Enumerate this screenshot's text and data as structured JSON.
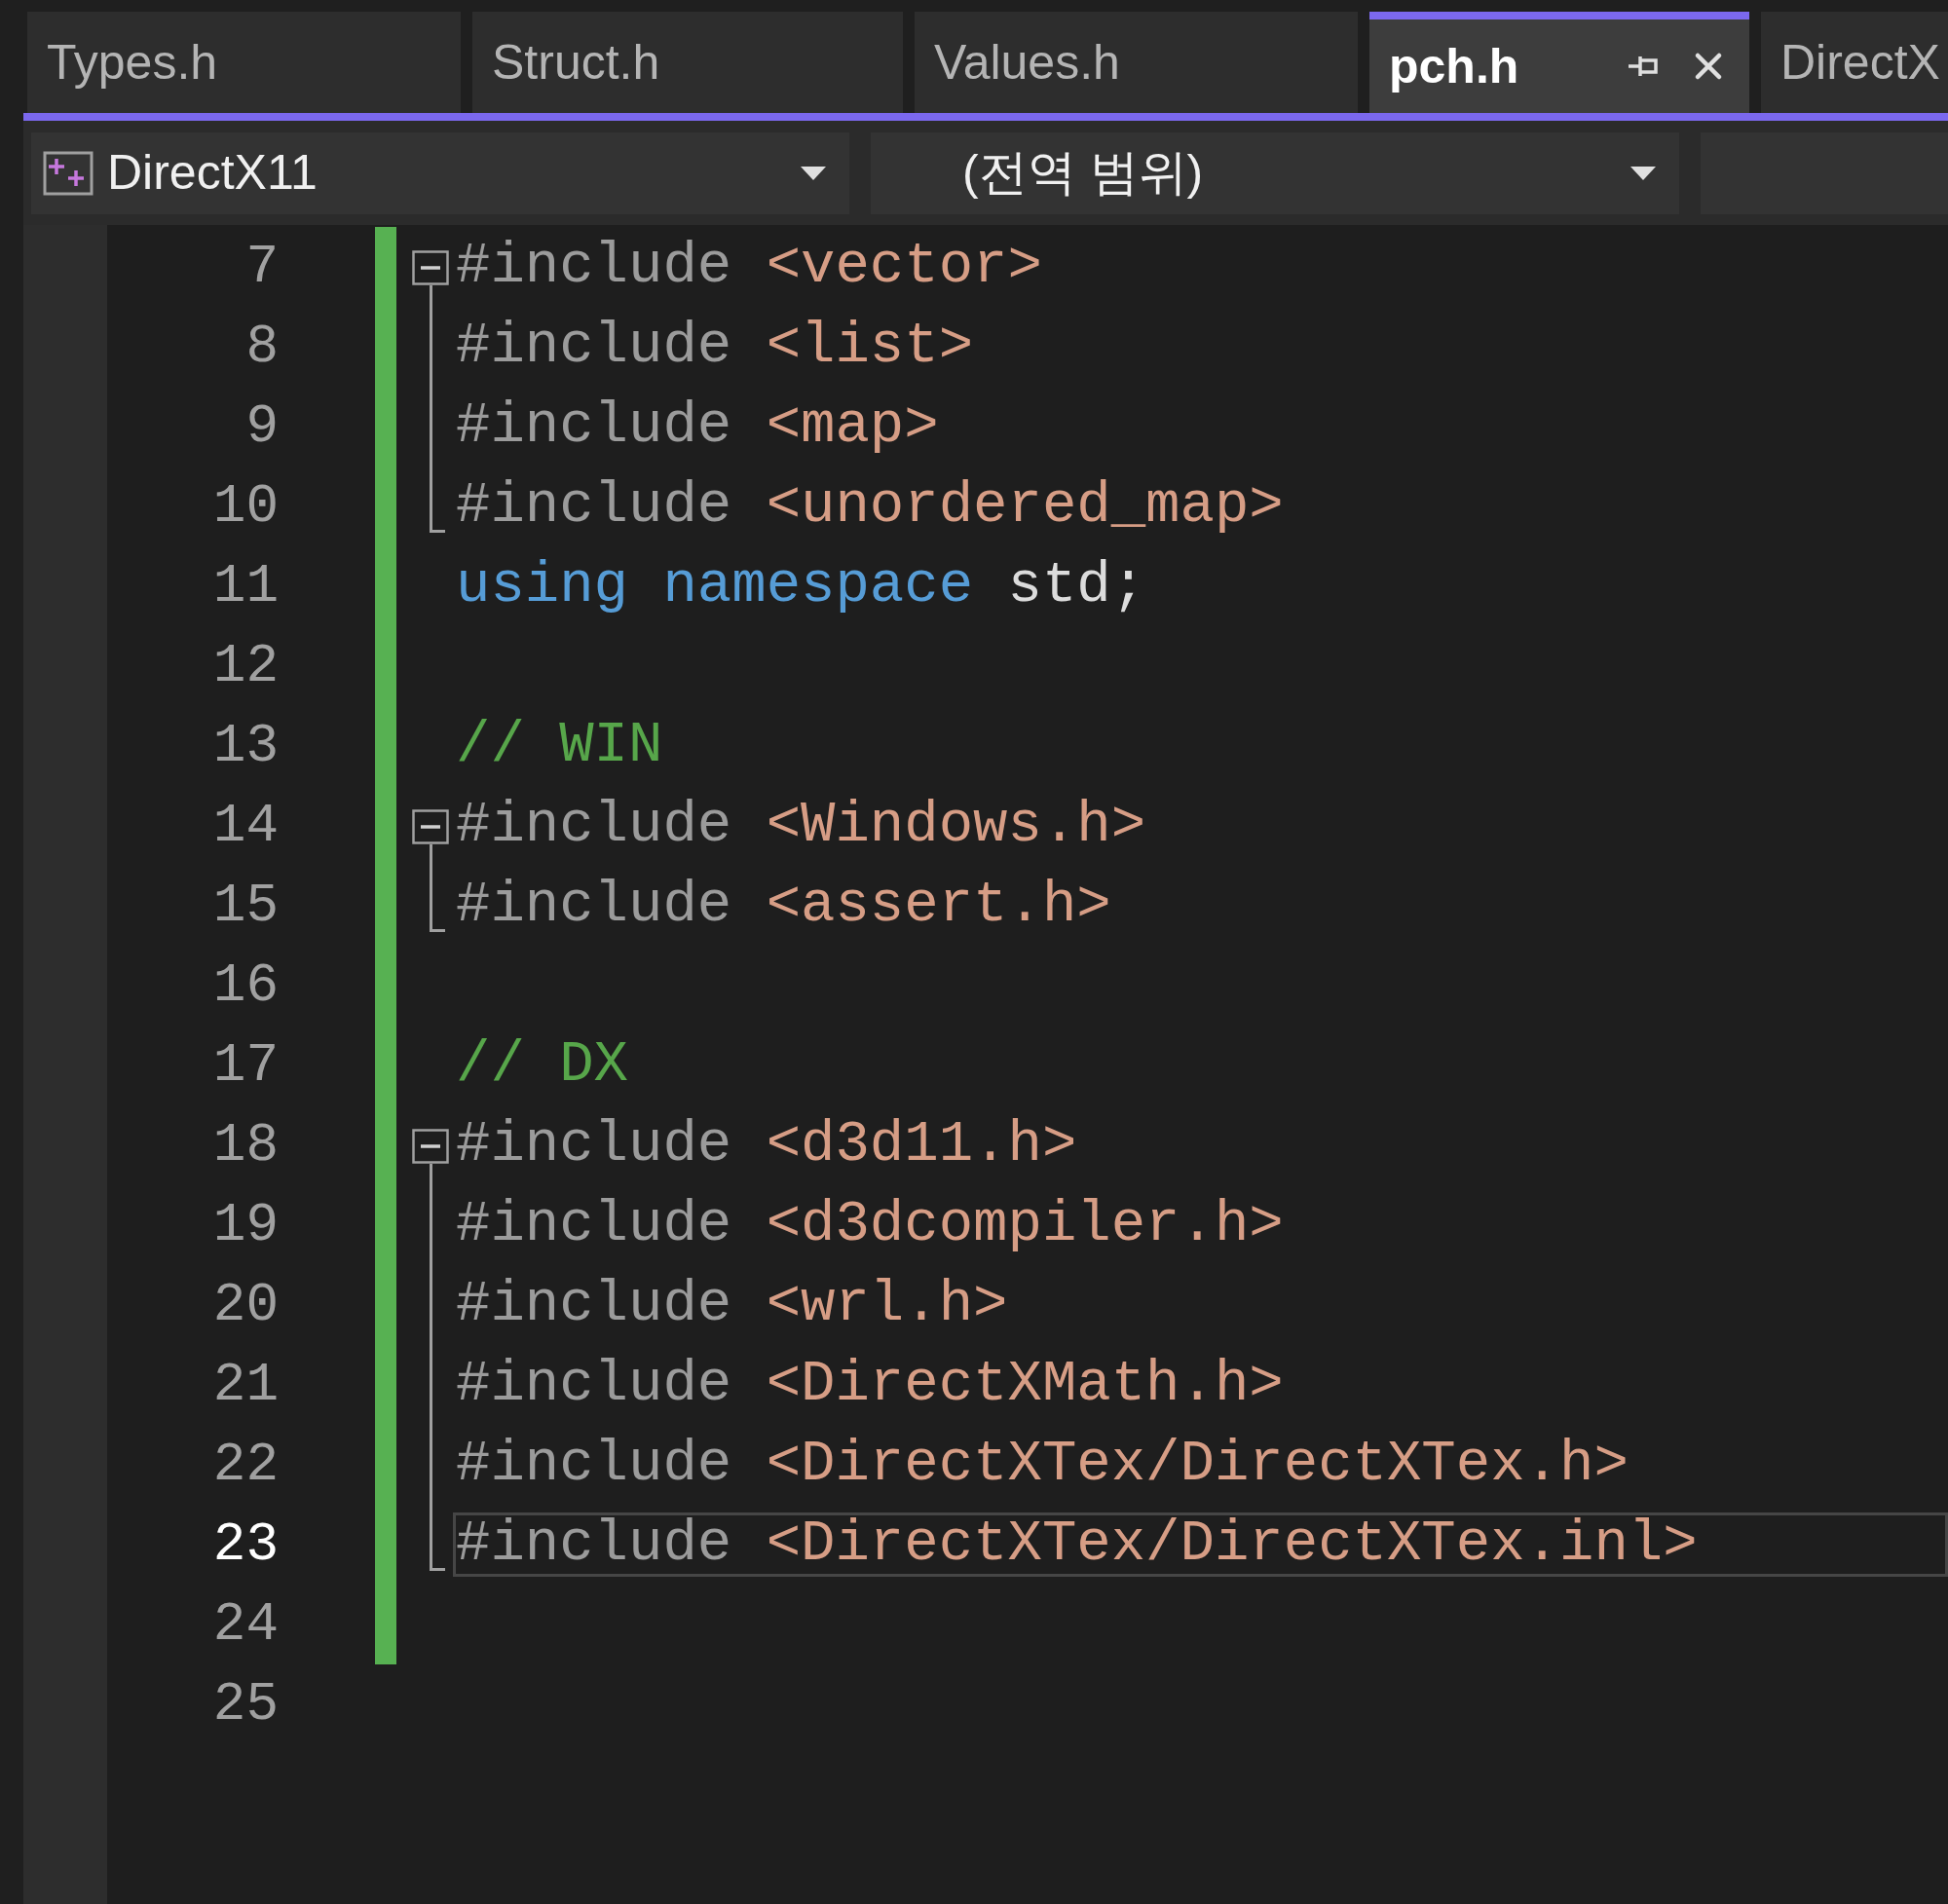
{
  "tabs": [
    {
      "label": "Types.h",
      "selected": false
    },
    {
      "label": "Struct.h",
      "selected": false
    },
    {
      "label": "Values.h",
      "selected": false
    },
    {
      "label": "pch.h",
      "selected": true
    },
    {
      "label": "DirectX",
      "selected": false
    }
  ],
  "toolbar": {
    "project": "DirectX11",
    "scope": "(전역 범위)"
  },
  "lines": [
    {
      "number": "7",
      "modified": true,
      "current": false,
      "fold_start": true,
      "tokens": [
        {
          "kind": "directive",
          "text": "#include "
        },
        {
          "kind": "string",
          "text": "<vector>"
        }
      ]
    },
    {
      "number": "8",
      "modified": true,
      "current": false,
      "tokens": [
        {
          "kind": "directive",
          "text": "#include "
        },
        {
          "kind": "string",
          "text": "<list>"
        }
      ]
    },
    {
      "number": "9",
      "modified": true,
      "current": false,
      "tokens": [
        {
          "kind": "directive",
          "text": "#include "
        },
        {
          "kind": "string",
          "text": "<map>"
        }
      ]
    },
    {
      "number": "10",
      "modified": true,
      "current": false,
      "fold_end": true,
      "tokens": [
        {
          "kind": "directive",
          "text": "#include "
        },
        {
          "kind": "string",
          "text": "<unordered_map>"
        }
      ]
    },
    {
      "number": "11",
      "modified": true,
      "current": false,
      "tokens": [
        {
          "kind": "keyword",
          "text": "using namespace "
        },
        {
          "kind": "plain",
          "text": "std;"
        }
      ]
    },
    {
      "number": "12",
      "modified": true,
      "current": false
    },
    {
      "number": "13",
      "modified": true,
      "current": false,
      "tokens": [
        {
          "kind": "comment",
          "text": "// WIN"
        }
      ]
    },
    {
      "number": "14",
      "modified": true,
      "current": false,
      "fold_start": true,
      "tokens": [
        {
          "kind": "directive",
          "text": "#include "
        },
        {
          "kind": "string",
          "text": "<Windows.h>"
        }
      ]
    },
    {
      "number": "15",
      "modified": true,
      "current": false,
      "fold_end": true,
      "tokens": [
        {
          "kind": "directive",
          "text": "#include "
        },
        {
          "kind": "string",
          "text": "<assert.h>"
        }
      ]
    },
    {
      "number": "16",
      "modified": true,
      "current": false
    },
    {
      "number": "17",
      "modified": true,
      "current": false,
      "tokens": [
        {
          "kind": "comment",
          "text": "// DX"
        }
      ]
    },
    {
      "number": "18",
      "modified": true,
      "current": false,
      "fold_start": true,
      "tokens": [
        {
          "kind": "directive",
          "text": "#include "
        },
        {
          "kind": "string",
          "text": "<d3d11.h>"
        }
      ]
    },
    {
      "number": "19",
      "modified": true,
      "current": false,
      "tokens": [
        {
          "kind": "directive",
          "text": "#include "
        },
        {
          "kind": "string",
          "text": "<d3dcompiler.h>"
        }
      ]
    },
    {
      "number": "20",
      "modified": true,
      "current": false,
      "tokens": [
        {
          "kind": "directive",
          "text": "#include "
        },
        {
          "kind": "string",
          "text": "<wrl.h>"
        }
      ]
    },
    {
      "number": "21",
      "modified": true,
      "current": false,
      "tokens": [
        {
          "kind": "directive",
          "text": "#include "
        },
        {
          "kind": "string",
          "text": "<DirectXMath.h>"
        }
      ]
    },
    {
      "number": "22",
      "modified": true,
      "current": false,
      "tokens": [
        {
          "kind": "directive",
          "text": "#include "
        },
        {
          "kind": "string",
          "text": "<DirectXTex/DirectXTex.h>"
        }
      ]
    },
    {
      "number": "23",
      "modified": true,
      "current": true,
      "fold_end": true,
      "tokens": [
        {
          "kind": "directive",
          "text": "#include "
        },
        {
          "kind": "string",
          "text": "<DirectXTex/DirectXTex.inl>"
        }
      ]
    },
    {
      "number": "24",
      "modified": true,
      "current": false
    },
    {
      "number": "25",
      "modified": false,
      "current": false
    }
  ]
}
